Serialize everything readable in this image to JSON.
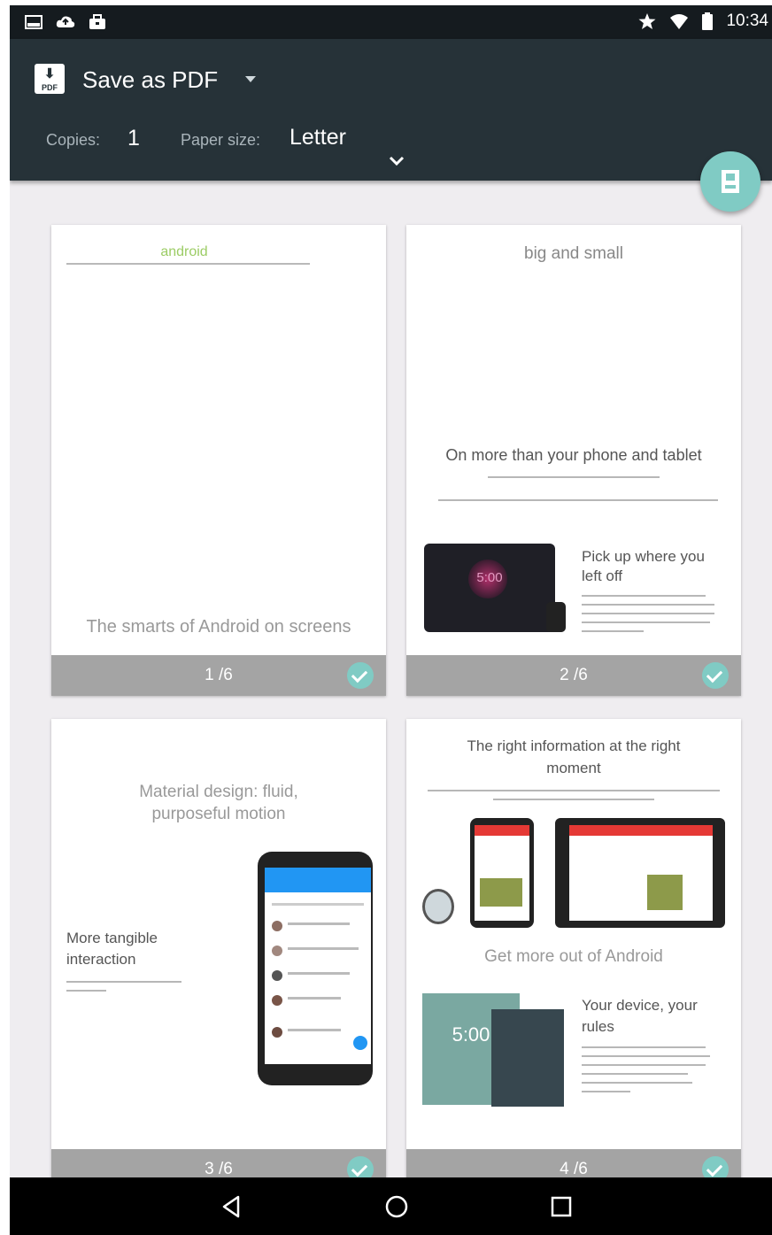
{
  "status_bar": {
    "time": "10:34",
    "icons_left": [
      "image-icon",
      "cloud-icon",
      "briefcase-icon"
    ],
    "icons_right": [
      "star-icon",
      "wifi-icon",
      "battery-icon"
    ]
  },
  "print_header": {
    "printer_name": "Save as PDF",
    "pdf_badge": "PDF",
    "copies_label": "Copies:",
    "copies_value": "1",
    "paper_size_label": "Paper size:",
    "paper_size_value": "Letter"
  },
  "pages": [
    {
      "label": "1 /6",
      "title": "android",
      "bottom_text": "The smarts of Android on screens"
    },
    {
      "label": "2 /6",
      "title": "big and small",
      "headline": "On more than your phone and tablet",
      "device_clock": "5:00",
      "side_title": "Pick up where you left off"
    },
    {
      "label": "3 /6",
      "title": "Material design: fluid, purposeful motion",
      "left_title": "More tangible interaction"
    },
    {
      "label": "4 /6",
      "title": "The right information at the right moment",
      "mid_title": "Get more out of Android",
      "device_clock": "5:00",
      "side_title": "Your device, your rules"
    }
  ],
  "nav_bar": {
    "buttons": [
      "back-icon",
      "home-icon",
      "recents-icon"
    ]
  },
  "colors": {
    "header": "#263238",
    "accent": "#80cbc4",
    "page_footer": "#a4a4a4",
    "status_bar": "#151b1f"
  }
}
